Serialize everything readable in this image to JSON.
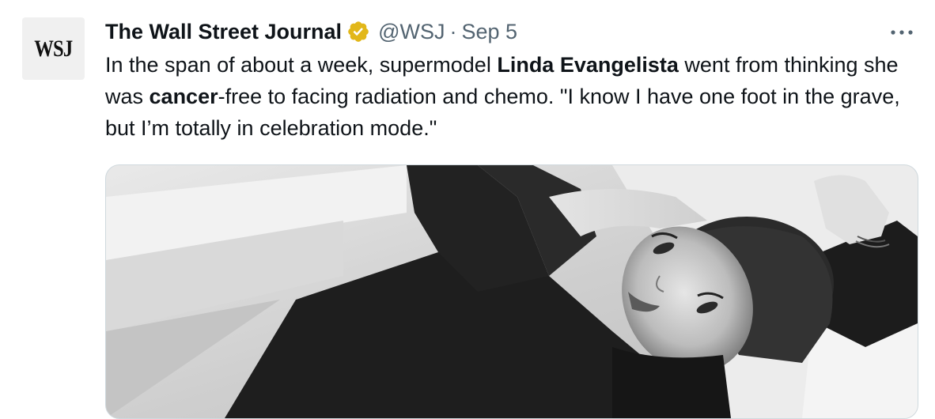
{
  "tweet": {
    "avatar_text": "WSJ",
    "author_name": "The Wall Street Journal",
    "handle": "@WSJ",
    "separator": "·",
    "date": "Sep 5",
    "more_icon": "more-horizontal-icon",
    "badge_icon": "verified-badge-icon",
    "text_segments": [
      {
        "text": "In the span of about a week, supermodel ",
        "bold": false
      },
      {
        "text": "Linda Evangelista",
        "bold": true
      },
      {
        "text": " went from thinking she was ",
        "bold": false
      },
      {
        "text": "cancer",
        "bold": true
      },
      {
        "text": "-free to facing radiation and chemo. \"I know I have one foot in the grave, but I’m totally in celebration mode.\"",
        "bold": false
      }
    ],
    "media": {
      "style": "black-and-white photo"
    }
  },
  "colors": {
    "text": "#0f1419",
    "secondary_text": "#536471",
    "badge_gold": "#e2b719",
    "media_border": "#cfd9de"
  }
}
